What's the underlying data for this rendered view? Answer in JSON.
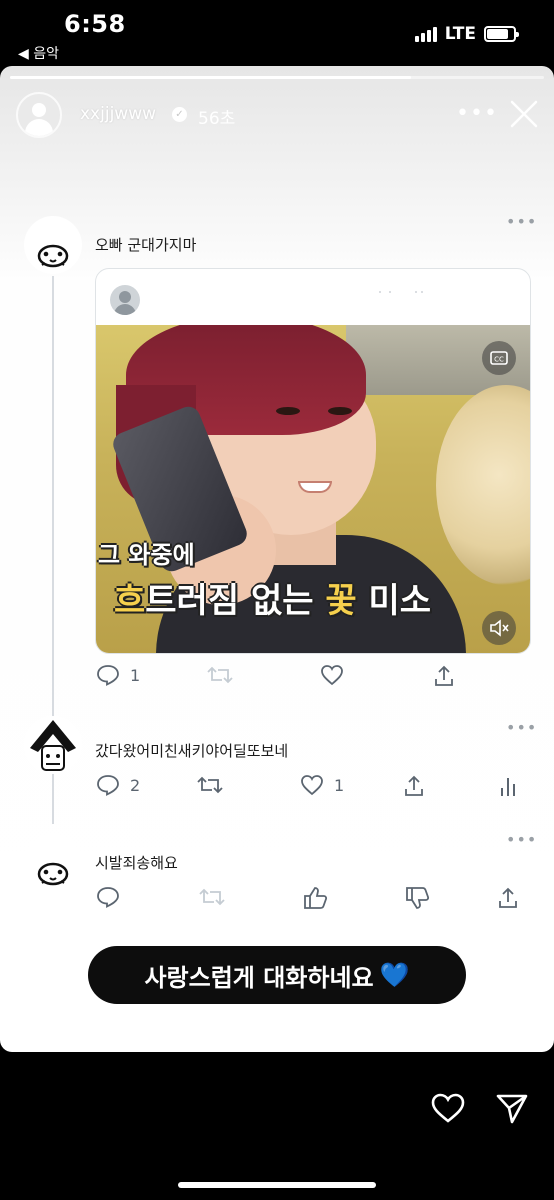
{
  "status_bar": {
    "time": "6:58",
    "back_app": "◀ 음악",
    "network": "LTE",
    "battery_level": 0.8
  },
  "story": {
    "progress": 0.75,
    "username": "xxjjjwww",
    "time_ago": "56초",
    "more_icon": "more-dots-icon",
    "close_icon": "close-icon"
  },
  "tweets": [
    {
      "text": "오빠 군대가지마",
      "reply_count": "1",
      "retweet_count": "",
      "like_count": "",
      "quote": {
        "subtitle_line1": "그 와중에",
        "subtitle_line2_a": "흐",
        "subtitle_line2_b": "트러짐 없는 ",
        "subtitle_line2_c": "꽃",
        "subtitle_line2_d": " 미소"
      }
    },
    {
      "text": "갔다왔어미친새키야어딜또보네",
      "reply_count": "2",
      "retweet_count": "",
      "like_count": "1"
    },
    {
      "text": "시발죄송해요"
    }
  ],
  "caption": {
    "text": "사랑스럽게 대화하네요",
    "emoji": "💙"
  },
  "colors": {
    "accent_blue": "#3b8bf0",
    "icon_gray": "#5b6570"
  }
}
